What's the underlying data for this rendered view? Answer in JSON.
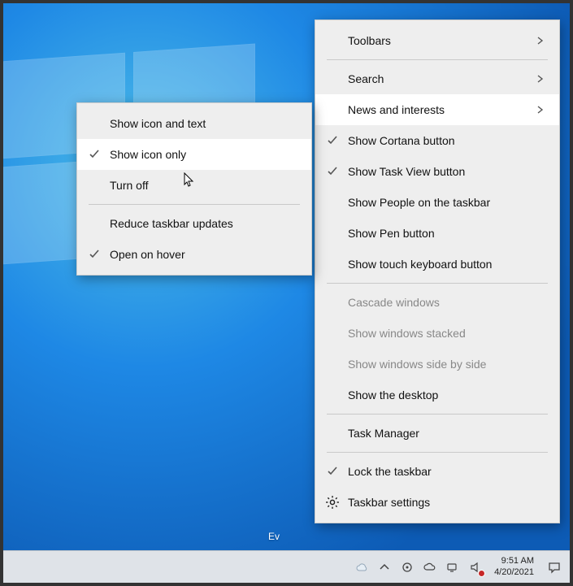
{
  "desktop": {
    "watermark_partial": "Ev"
  },
  "main_menu": {
    "toolbars": "Toolbars",
    "search": "Search",
    "news": "News and interests",
    "cortana": "Show Cortana button",
    "taskview": "Show Task View button",
    "people": "Show People on the taskbar",
    "pen": "Show Pen button",
    "touchkb": "Show touch keyboard button",
    "cascade": "Cascade windows",
    "stacked": "Show windows stacked",
    "sidebyside": "Show windows side by side",
    "showdesk": "Show the desktop",
    "taskmgr": "Task Manager",
    "lock": "Lock the taskbar",
    "settings": "Taskbar settings"
  },
  "sub_menu": {
    "icon_text": "Show icon and text",
    "icon_only": "Show icon only",
    "turn_off": "Turn off",
    "reduce": "Reduce taskbar updates",
    "hover": "Open on hover"
  },
  "taskbar": {
    "time": "9:51 AM",
    "date": "4/20/2021"
  }
}
